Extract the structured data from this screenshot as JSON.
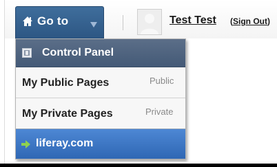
{
  "dockbar": {
    "goto_label": "Go to",
    "home_icon": "home-icon",
    "dropdown_icon": "chevron-down-icon",
    "user_name": "Test Test",
    "sign_out_open": "(",
    "sign_out_label": "Sign Out",
    "sign_out_close": ")"
  },
  "menu": {
    "items": [
      {
        "label": "Control Panel",
        "icon": "control-panel-icon"
      },
      {
        "label": "My Public Pages",
        "tag": "Public"
      },
      {
        "label": "My Private Pages",
        "tag": "Private"
      },
      {
        "label": "liferay.com",
        "icon": "arrow-right-icon"
      }
    ]
  },
  "colors": {
    "goto_button": "#3a6794",
    "control_panel_header": "#4f637f",
    "selected_item": "#3d76c4",
    "tag_text": "#8a8a8a"
  }
}
